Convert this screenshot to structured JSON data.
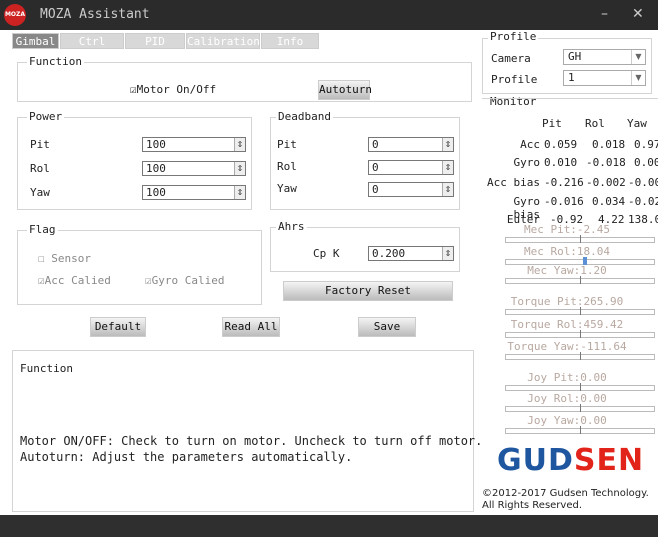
{
  "window": {
    "title": "MOZA Assistant",
    "logo_text": "MOZA"
  },
  "tabs": [
    {
      "label": "Gimbal"
    },
    {
      "label": "Ctrl"
    },
    {
      "label": "PID"
    },
    {
      "label": "Calibration"
    },
    {
      "label": "Info"
    }
  ],
  "function_group": {
    "title": "Function",
    "motor_label": "Motor On/Off",
    "motor_checked": true,
    "autoturn_label": "Autoturn"
  },
  "power": {
    "title": "Power",
    "rows": [
      {
        "label": "Pit",
        "value": "100"
      },
      {
        "label": "Rol",
        "value": "100"
      },
      {
        "label": "Yaw",
        "value": "100"
      }
    ]
  },
  "deadband": {
    "title": "Deadband",
    "rows": [
      {
        "label": "Pit",
        "value": "0"
      },
      {
        "label": "Rol",
        "value": "0"
      },
      {
        "label": "Yaw",
        "value": "0"
      }
    ]
  },
  "flag": {
    "title": "Flag",
    "sensor": "Sensor",
    "acc": "Acc Calied",
    "gyro": "Gyro Calied"
  },
  "ahrs": {
    "title": "Ahrs",
    "cpk_label": "Cp K",
    "cpk_value": "0.200"
  },
  "buttons": {
    "factory_reset": "Factory Reset",
    "default": "Default",
    "read_all": "Read All",
    "save": "Save"
  },
  "desc": {
    "title": "Function",
    "line1": "Motor ON/OFF: Check to turn on motor. Uncheck to turn off motor.",
    "line2": "Autoturn: Adjust the parameters automatically."
  },
  "profile": {
    "title": "Profile",
    "camera_label": "Camera",
    "camera_value": "GH",
    "profile_label": "Profile",
    "profile_value": "1"
  },
  "monitor": {
    "title": "Monitor",
    "headers": [
      "Pit",
      "Rol",
      "Yaw"
    ],
    "rows": [
      {
        "label": "Acc",
        "pit": "0.059",
        "rol": "0.018",
        "yaw": "0.97"
      },
      {
        "label": "Gyro",
        "pit": "0.010",
        "rol": "-0.018",
        "yaw": "0.00"
      },
      {
        "label": "Acc bias",
        "pit": "-0.216",
        "rol": "-0.002",
        "yaw": "-0.00"
      },
      {
        "label": "Gyro bias",
        "pit": "-0.016",
        "rol": "0.034",
        "yaw": "-0.02"
      },
      {
        "label": "Euler",
        "pit": "-0.92",
        "rol": "4.22",
        "yaw": "138.0"
      }
    ],
    "sliders": [
      {
        "label": "Mec Pit:-2.45",
        "level": 0.5
      },
      {
        "label": "Mec Rol:18.04",
        "level": 0.52
      },
      {
        "label": "Mec Yaw:1.20",
        "level": 0.5
      },
      {
        "label": "Torque Pit:265.90",
        "level": 0.5
      },
      {
        "label": "Torque Rol:459.42",
        "level": 0.5
      },
      {
        "label": "Torque Yaw:-111.64",
        "level": 0.5
      },
      {
        "label": "Joy Pit:0.00",
        "level": 0.5
      },
      {
        "label": "Joy Rol:0.00",
        "level": 0.5
      },
      {
        "label": "Joy Yaw:0.00",
        "level": 0.5
      }
    ]
  },
  "brand": {
    "logo": "GUDSEN",
    "copyright1": "©2012-2017 Gudsen Technology.",
    "copyright2": "All Rights Reserved."
  },
  "colors": {
    "titlebar": "#2b2b2b",
    "brand_blue": "#1e56a0",
    "brand_red": "#e2231a"
  }
}
